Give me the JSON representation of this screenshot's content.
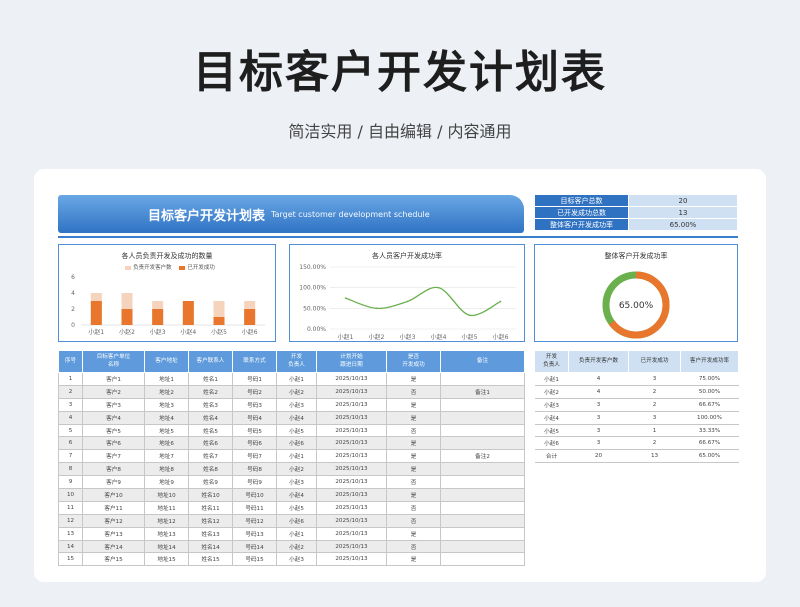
{
  "header": {
    "title": "目标客户开发计划表",
    "subtitle": "简洁实用 / 自由编辑 / 内容通用"
  },
  "banner": {
    "title": "目标客户开发计划表",
    "english": "Target customer development schedule"
  },
  "summary": [
    {
      "label": "目标客户总数",
      "value": "20"
    },
    {
      "label": "已开发成功总数",
      "value": "13"
    },
    {
      "label": "整体客户开发成功率",
      "value": "65.00%"
    }
  ],
  "colors": {
    "accent": "#2f72c2",
    "orange": "#e8762d",
    "light_orange": "#f6d3bd",
    "green": "#6ab04c"
  },
  "chart_data": [
    {
      "type": "bar",
      "title": "各人员负责开发及成功的数量",
      "categories": [
        "小赵1",
        "小赵2",
        "小赵3",
        "小赵4",
        "小赵5",
        "小赵6"
      ],
      "series": [
        {
          "name": "负责开发客户数",
          "values": [
            4,
            4,
            3,
            3,
            3,
            3
          ]
        },
        {
          "name": "已开发成功",
          "values": [
            3,
            2,
            2,
            3,
            1,
            2
          ]
        }
      ],
      "ylim": [
        0,
        6
      ],
      "yticks": [
        "0",
        "2",
        "4",
        "6"
      ],
      "grid": false,
      "legend": "top"
    },
    {
      "type": "line",
      "title": "各人员客户开发成功率",
      "categories": [
        "小赵1",
        "小赵2",
        "小赵3",
        "小赵4",
        "小赵5",
        "小赵6"
      ],
      "series": [
        {
          "values": [
            75,
            50,
            66.67,
            100,
            33.33,
            66.67
          ]
        }
      ],
      "ylim": [
        0,
        150
      ],
      "yticks": [
        "0.00%",
        "50.00%",
        "100.00%",
        "150.00%"
      ],
      "grid": true
    },
    {
      "type": "pie",
      "title": "整体客户开发成功率",
      "values": [
        65,
        35
      ],
      "center_label": "65.00%"
    }
  ],
  "main_table": {
    "headers": [
      "序号",
      "目标客户单位\n名称",
      "客户地址",
      "客户联系人",
      "联系方式",
      "开发\n负责人",
      "计划开始\n跟进日期",
      "是否\n开发成功",
      "备注"
    ],
    "rows": [
      [
        "1",
        "客户1",
        "地址1",
        "姓名1",
        "号码1",
        "小赵1",
        "2025/10/13",
        "是",
        ""
      ],
      [
        "2",
        "客户2",
        "地址2",
        "姓名2",
        "号码2",
        "小赵2",
        "2025/10/13",
        "否",
        "备注1"
      ],
      [
        "3",
        "客户3",
        "地址3",
        "姓名3",
        "号码3",
        "小赵3",
        "2025/10/13",
        "是",
        ""
      ],
      [
        "4",
        "客户4",
        "地址4",
        "姓名4",
        "号码4",
        "小赵4",
        "2025/10/13",
        "是",
        ""
      ],
      [
        "5",
        "客户5",
        "地址5",
        "姓名5",
        "号码5",
        "小赵5",
        "2025/10/13",
        "否",
        ""
      ],
      [
        "6",
        "客户6",
        "地址6",
        "姓名6",
        "号码6",
        "小赵6",
        "2025/10/13",
        "是",
        ""
      ],
      [
        "7",
        "客户7",
        "地址7",
        "姓名7",
        "号码7",
        "小赵1",
        "2025/10/13",
        "是",
        "备注2"
      ],
      [
        "8",
        "客户8",
        "地址8",
        "姓名8",
        "号码8",
        "小赵2",
        "2025/10/13",
        "是",
        ""
      ],
      [
        "9",
        "客户9",
        "地址9",
        "姓名9",
        "号码9",
        "小赵3",
        "2025/10/13",
        "否",
        ""
      ],
      [
        "10",
        "客户10",
        "地址10",
        "姓名10",
        "号码10",
        "小赵4",
        "2025/10/13",
        "是",
        ""
      ],
      [
        "11",
        "客户11",
        "地址11",
        "姓名11",
        "号码11",
        "小赵5",
        "2025/10/13",
        "否",
        ""
      ],
      [
        "12",
        "客户12",
        "地址12",
        "姓名12",
        "号码12",
        "小赵6",
        "2025/10/13",
        "否",
        ""
      ],
      [
        "13",
        "客户13",
        "地址13",
        "姓名13",
        "号码13",
        "小赵1",
        "2025/10/13",
        "是",
        ""
      ],
      [
        "14",
        "客户14",
        "地址14",
        "姓名14",
        "号码14",
        "小赵2",
        "2025/10/13",
        "否",
        ""
      ],
      [
        "15",
        "客户15",
        "地址15",
        "姓名15",
        "号码15",
        "小赵3",
        "2025/10/13",
        "是",
        ""
      ]
    ]
  },
  "side_table": {
    "headers": [
      "开发\n负责人",
      "负责开发客户数",
      "已开发成功",
      "客户开发成功率"
    ],
    "rows": [
      [
        "小赵1",
        "4",
        "3",
        "75.00%"
      ],
      [
        "小赵2",
        "4",
        "2",
        "50.00%"
      ],
      [
        "小赵3",
        "3",
        "2",
        "66.67%"
      ],
      [
        "小赵4",
        "3",
        "3",
        "100.00%"
      ],
      [
        "小赵5",
        "3",
        "1",
        "33.33%"
      ],
      [
        "小赵6",
        "3",
        "2",
        "66.67%"
      ],
      [
        "合计",
        "20",
        "13",
        "65.00%"
      ]
    ]
  }
}
